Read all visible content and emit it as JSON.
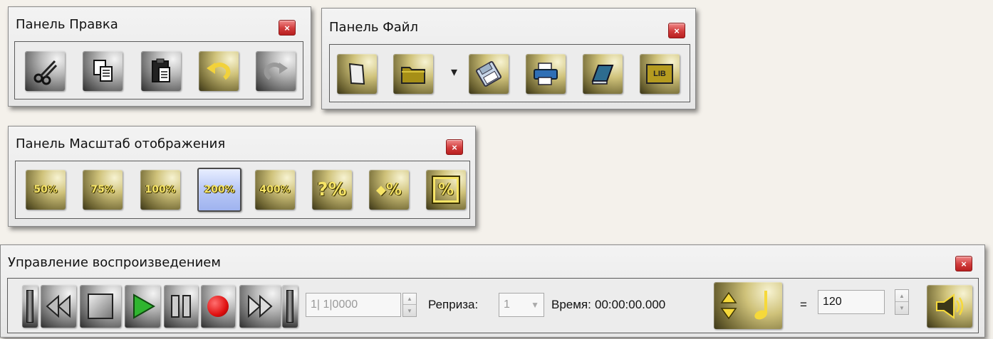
{
  "panels": {
    "edit": {
      "title": "Панель Правка",
      "close": "×",
      "buttons": [
        {
          "name": "cut-button",
          "icon": "scissors-icon"
        },
        {
          "name": "copy-button",
          "icon": "copy-icon"
        },
        {
          "name": "paste-button",
          "icon": "clipboard-icon"
        },
        {
          "name": "undo-button",
          "icon": "undo-arrow-icon"
        },
        {
          "name": "redo-button",
          "icon": "redo-arrow-icon"
        }
      ]
    },
    "file": {
      "title": "Панель Файл",
      "close": "×",
      "dropdown_arrow": "▾",
      "lib_label": "LIB"
    },
    "zoom": {
      "title": "Панель Масштаб отображения",
      "close": "×",
      "buttons": [
        "50%",
        "75%",
        "100%",
        "200%",
        "400%",
        "?%",
        "%"
      ],
      "selected": "200%"
    },
    "playback": {
      "title": "Управление воспроизведением",
      "close": "×",
      "position_value": "1| 1|0000",
      "reprise_label": "Репризa:",
      "reprise_value": "1",
      "time_label": "Время:",
      "time_value": "00:00:00.000",
      "equals": "=",
      "tempo_value": "120"
    }
  },
  "colors": {
    "close_red": "#d03a3a",
    "play_green": "#2fb52f",
    "record_red": "#e01010",
    "gold_text": "#f6e466",
    "selection_blue": "#b9c8f6"
  }
}
